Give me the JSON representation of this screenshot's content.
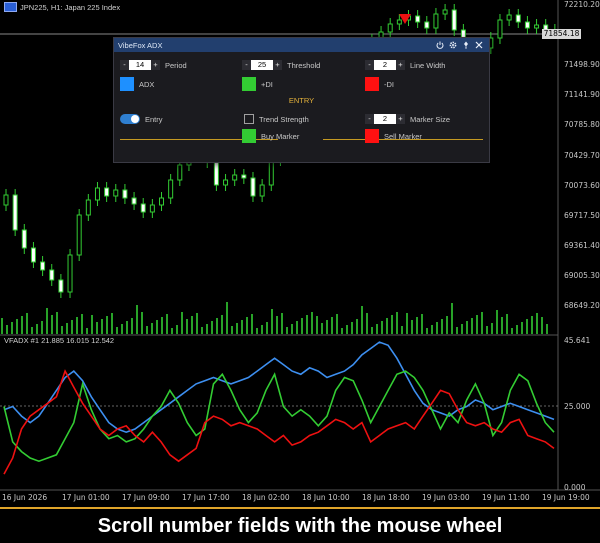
{
  "chart": {
    "symbol_label": "JPN225, H1:  Japan 225 Index",
    "indicator_label": "VFADX #1 21.885 16.015 12.542",
    "current_price": "71854.18",
    "price_ticks": [
      "72210.20",
      "71854.18",
      "71498.90",
      "71141.90",
      "70785.80",
      "70429.70",
      "70073.60",
      "69717.50",
      "69361.40",
      "69005.30",
      "68649.20"
    ],
    "ind_ticks": [
      "45.641",
      "25.000",
      "0.000"
    ],
    "time_ticks": [
      "16 Jun 2026",
      "17 Jun 01:00",
      "17 Jun 09:00",
      "17 Jun 17:00",
      "18 Jun 02:00",
      "18 Jun 10:00",
      "18 Jun 18:00",
      "19 Jun 03:00",
      "19 Jun 11:00",
      "19 Jun 19:00"
    ],
    "colors": {
      "candle": "#33cc33",
      "adx": "#3d8ff0",
      "plus_di": "#33cc33",
      "minus_di": "#ee1111",
      "signal": "#ee1111"
    }
  },
  "chart_data": {
    "type": "line",
    "title": "",
    "series": [
      {
        "name": "ADX",
        "values": [
          24,
          25,
          22,
          20,
          22,
          26,
          30,
          34,
          36,
          33,
          28,
          24,
          20,
          18,
          17,
          18,
          20,
          22,
          24,
          26,
          28,
          30,
          32,
          33,
          34,
          33,
          32,
          33,
          34,
          36,
          38,
          40,
          38,
          36,
          35,
          37,
          36,
          34,
          35,
          36,
          38,
          41,
          43,
          45,
          44,
          40,
          35,
          30,
          26,
          24,
          23,
          22,
          24,
          25,
          27,
          26,
          24,
          25,
          26,
          25,
          24,
          23,
          22,
          21
        ]
      },
      {
        "name": "+DI",
        "values": [
          25,
          14,
          11,
          9,
          8,
          9,
          10,
          15,
          20,
          32,
          24,
          18,
          15,
          16,
          14,
          15,
          18,
          22,
          25,
          30,
          26,
          20,
          16,
          18,
          32,
          35,
          30,
          24,
          20,
          23,
          30,
          35,
          25,
          22,
          24,
          22,
          19,
          22,
          30,
          34,
          33,
          27,
          20,
          25,
          30,
          35,
          36,
          34,
          30,
          24,
          18,
          23,
          20,
          27,
          32,
          26,
          16,
          20,
          30,
          35,
          33,
          26,
          20,
          17
        ]
      },
      {
        "name": "-DI",
        "values": [
          4,
          9,
          18,
          22,
          24,
          26,
          28,
          36,
          31,
          26,
          22,
          18,
          16,
          18,
          19,
          16,
          14,
          17,
          14,
          10,
          8,
          10,
          12,
          20,
          22,
          21,
          19,
          20,
          19,
          18,
          16,
          14,
          16,
          13,
          14,
          16,
          17,
          19,
          21,
          20,
          18,
          20,
          14,
          16,
          18,
          19,
          20,
          18,
          22,
          26,
          30,
          29,
          24,
          20,
          19,
          20,
          18,
          17,
          20,
          21,
          16,
          15,
          14,
          12
        ]
      }
    ],
    "ylim": [
      0,
      45.641
    ]
  },
  "panel": {
    "title": "VibeFox ADX",
    "header_icons": [
      "power-icon",
      "gear-icon",
      "pin-icon",
      "close-icon"
    ],
    "period": {
      "label": "Period",
      "value": "14"
    },
    "threshold": {
      "label": "Threshold",
      "value": "25"
    },
    "line_width": {
      "label": "Line Width",
      "value": "2"
    },
    "adx_color": {
      "label": "ADX",
      "color": "#1e90ff"
    },
    "plus_di_color": {
      "label": "+DI",
      "color": "#33cc33"
    },
    "minus_di_color": {
      "label": "-DI",
      "color": "#ff1111"
    },
    "section_title": "ENTRY",
    "entry": {
      "label": "Entry",
      "on": true
    },
    "trend_strength": {
      "label": "Trend Strength",
      "checked": false
    },
    "marker_size": {
      "label": "Marker Size",
      "value": "2"
    },
    "buy_marker": {
      "label": "Buy Marker",
      "color": "#33cc33"
    },
    "sell_marker": {
      "label": "Sell Marker",
      "color": "#ff1111"
    },
    "minus": "-",
    "plus": "+"
  },
  "caption": "Scroll number fields with the mouse wheel"
}
